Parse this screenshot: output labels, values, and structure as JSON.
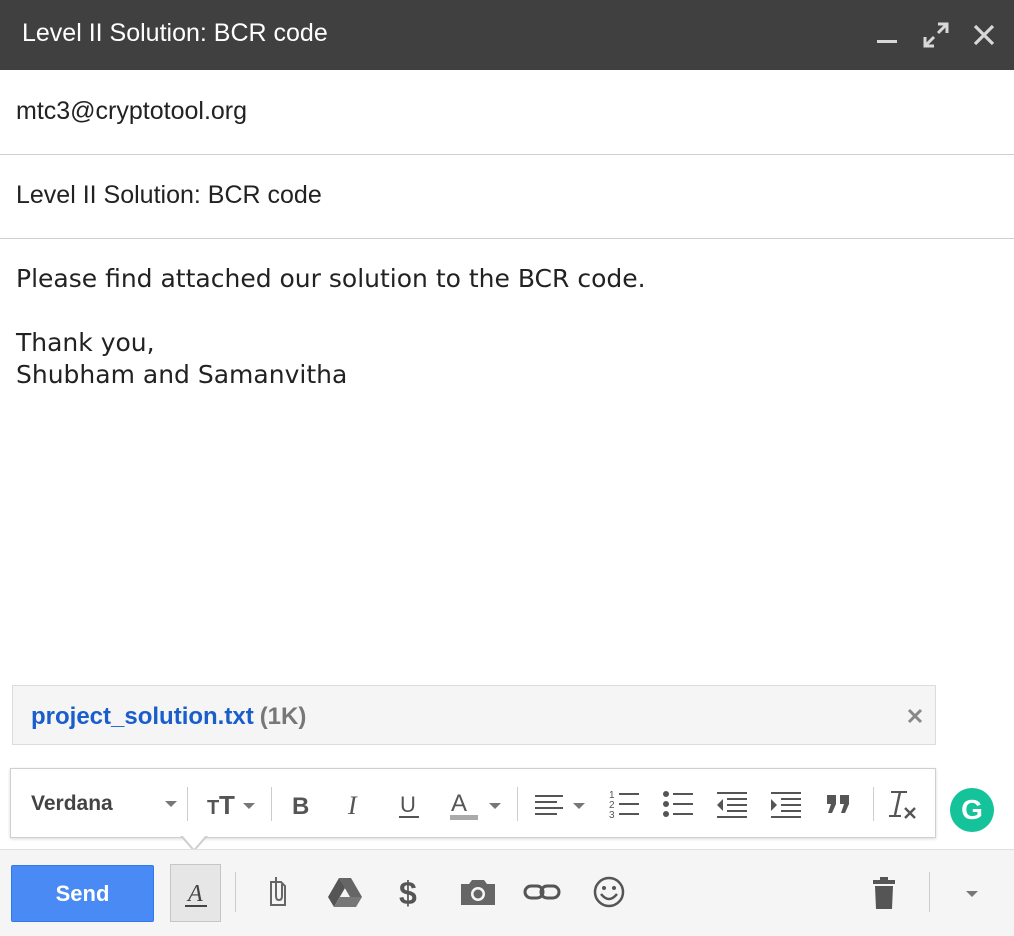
{
  "window": {
    "title": "Level II Solution: BCR code"
  },
  "compose": {
    "to": "mtc3@cryptotool.org",
    "subject": "Level II Solution: BCR code",
    "body_lines": [
      "Please find attached our solution to the BCR code.",
      "",
      "Thank you,",
      "Shubham and Samanvitha"
    ]
  },
  "attachment": {
    "filename": "project_solution.txt",
    "size": "(1K)"
  },
  "formatting": {
    "font": "Verdana",
    "tools": [
      "text-size-icon",
      "bold-icon",
      "italic-icon",
      "underline-icon",
      "text-color-icon",
      "align-icon",
      "numbered-list-icon",
      "bulleted-list-icon",
      "indent-less-icon",
      "indent-more-icon",
      "quote-icon",
      "remove-formatting-icon"
    ]
  },
  "actions": {
    "send_label": "Send",
    "icons": [
      "formatting-options-icon",
      "attach-files-icon",
      "insert-drive-icon",
      "insert-money-icon",
      "insert-photo-icon",
      "insert-link-icon",
      "insert-emoji-icon",
      "discard-draft-icon",
      "more-options-icon"
    ]
  },
  "colors": {
    "titlebar": "#404040",
    "send_button": "#4a8af4",
    "attachment_link": "#1a5ecb",
    "grammarly": "#15c39a"
  }
}
